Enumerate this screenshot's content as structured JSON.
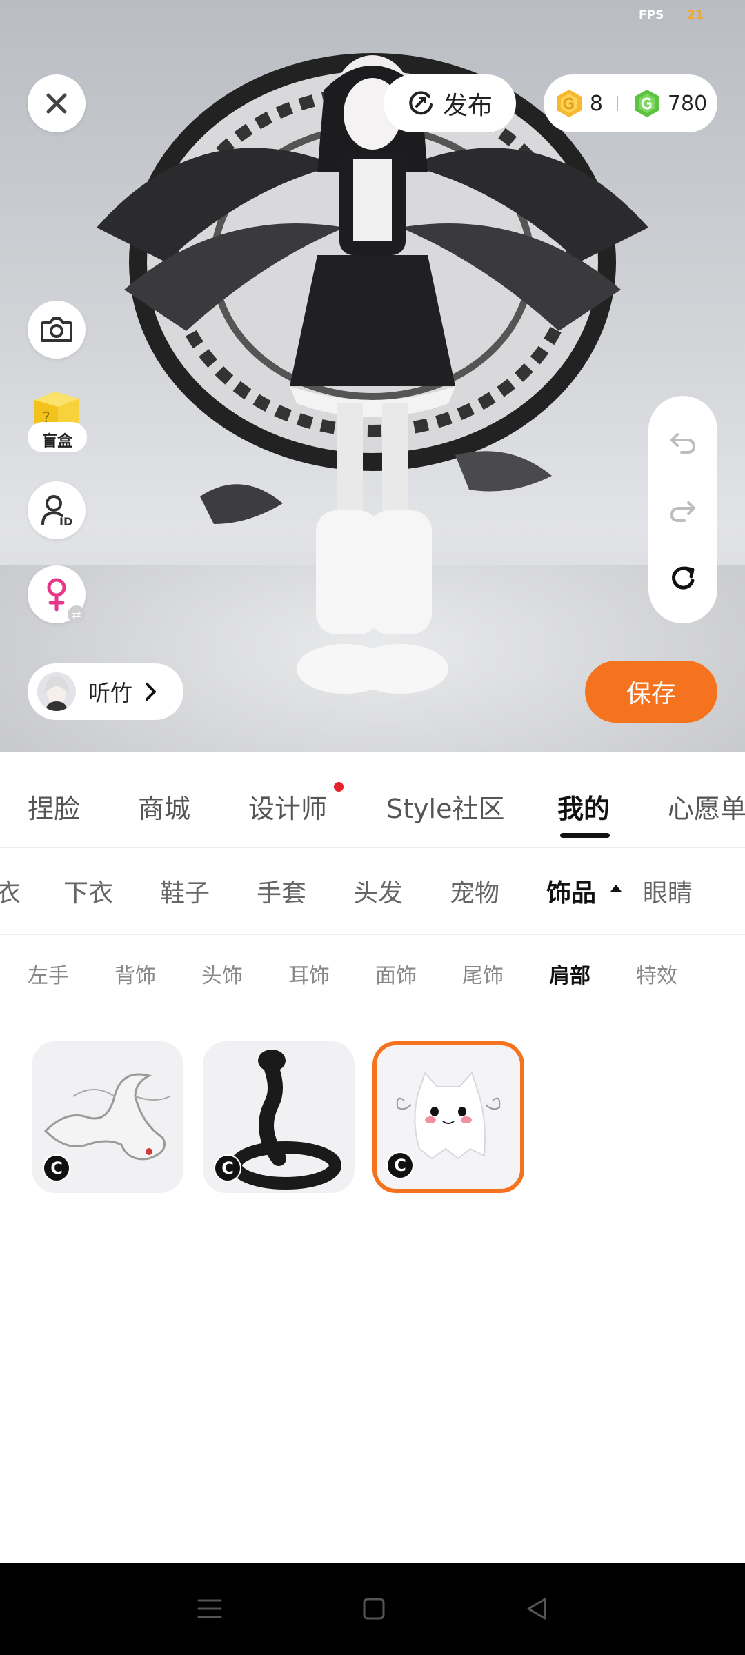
{
  "status": {
    "fps_label": "FPS",
    "fps_value": "21"
  },
  "preview": {
    "publish_label": "发布",
    "currency": {
      "gold": "8",
      "green": "780"
    },
    "blindbox_label": "盲盒",
    "user_name": "听竹",
    "save_label": "保存"
  },
  "main_tabs": [
    "捏脸",
    "商城",
    "设计师",
    "Style社区",
    "我的",
    "心愿单"
  ],
  "main_tab_active": "我的",
  "category_tabs": [
    "衣",
    "下衣",
    "鞋子",
    "手套",
    "头发",
    "宠物",
    "饰品",
    "眼睛"
  ],
  "category_active": "饰品",
  "sub_tabs": [
    "左手",
    "背饰",
    "头饰",
    "耳饰",
    "面饰",
    "尾饰",
    "肩部",
    "特效"
  ],
  "sub_tab_active": "肩部",
  "items": [
    {
      "icon": "white-dragon",
      "badge": "C",
      "selected": false
    },
    {
      "icon": "black-cobra",
      "badge": "C",
      "selected": false
    },
    {
      "icon": "ghost-cat",
      "badge": "C",
      "selected": true
    }
  ],
  "colors": {
    "accent": "#f5731f",
    "notification": "#e6212b",
    "gold": "#f5b82e",
    "green": "#5cc341"
  }
}
